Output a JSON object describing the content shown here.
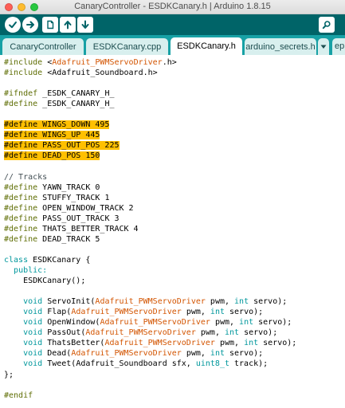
{
  "window": {
    "title": "CanaryController - ESDKCanary.h | Arduino 1.8.15"
  },
  "toolbar": {
    "buttons": [
      {
        "name": "verify",
        "icon": "checkmark-icon"
      },
      {
        "name": "upload",
        "icon": "arrow-right-icon"
      },
      {
        "name": "new",
        "icon": "new-file-icon"
      },
      {
        "name": "open",
        "icon": "arrow-up-icon"
      },
      {
        "name": "save",
        "icon": "arrow-down-icon"
      },
      {
        "name": "serial-monitor",
        "icon": "magnifier-icon"
      }
    ]
  },
  "tabs": [
    {
      "label": "CanaryController",
      "active": false
    },
    {
      "label": "ESDKCanary.cpp",
      "active": false
    },
    {
      "label": "ESDKCanary.h",
      "active": true
    },
    {
      "label": "arduino_secrets.h",
      "active": false
    },
    {
      "label": "ep",
      "active": false
    }
  ],
  "colors": {
    "toolbar": "#006468",
    "tabbar": "#17a1a5",
    "preprocessor": "#5e6d03",
    "keyword": "#00979c",
    "library_class": "#d35400",
    "highlight": "#ffc000"
  },
  "code": [
    [
      {
        "t": "#include ",
        "c": "pre"
      },
      {
        "t": "<",
        "c": ""
      },
      {
        "t": "Adafruit_PWMServoDriver",
        "c": "lib"
      },
      {
        "t": ".h>",
        "c": ""
      }
    ],
    [
      {
        "t": "#include ",
        "c": "pre"
      },
      {
        "t": "<Adafruit_Soundboard.h>",
        "c": ""
      }
    ],
    [],
    [
      {
        "t": "#ifndef ",
        "c": "pre"
      },
      {
        "t": "_ESDK_CANARY_H_",
        "c": ""
      }
    ],
    [
      {
        "t": "#define ",
        "c": "pre"
      },
      {
        "t": "_ESDK_CANARY_H_",
        "c": ""
      }
    ],
    [],
    [
      {
        "t": "#define WINGS_DOWN 495",
        "c": "hl"
      }
    ],
    [
      {
        "t": "#define WINGS_UP 445",
        "c": "hl"
      }
    ],
    [
      {
        "t": "#define PASS_OUT_POS 225",
        "c": "hl"
      }
    ],
    [
      {
        "t": "#define DEAD_POS 150",
        "c": "hl"
      }
    ],
    [],
    [
      {
        "t": "// Tracks",
        "c": "cmt"
      }
    ],
    [
      {
        "t": "#define ",
        "c": "pre"
      },
      {
        "t": "YAWN_TRACK 0",
        "c": ""
      }
    ],
    [
      {
        "t": "#define ",
        "c": "pre"
      },
      {
        "t": "STUFFY_TRACK 1",
        "c": ""
      }
    ],
    [
      {
        "t": "#define ",
        "c": "pre"
      },
      {
        "t": "OPEN_WINDOW_TRACK 2",
        "c": ""
      }
    ],
    [
      {
        "t": "#define ",
        "c": "pre"
      },
      {
        "t": "PASS_OUT_TRACK 3",
        "c": ""
      }
    ],
    [
      {
        "t": "#define ",
        "c": "pre"
      },
      {
        "t": "THATS_BETTER_TRACK 4",
        "c": ""
      }
    ],
    [
      {
        "t": "#define ",
        "c": "pre"
      },
      {
        "t": "DEAD_TRACK 5",
        "c": ""
      }
    ],
    [],
    [
      {
        "t": "class ",
        "c": "kw"
      },
      {
        "t": "ESDKCanary {",
        "c": ""
      }
    ],
    [
      {
        "t": "  ",
        "c": ""
      },
      {
        "t": "public:",
        "c": "kw"
      }
    ],
    [
      {
        "t": "    ESDKCanary();",
        "c": ""
      }
    ],
    [],
    [
      {
        "t": "    ",
        "c": ""
      },
      {
        "t": "void ",
        "c": "kw"
      },
      {
        "t": "ServoInit(",
        "c": ""
      },
      {
        "t": "Adafruit_PWMServoDriver",
        "c": "lib"
      },
      {
        "t": " pwm, ",
        "c": ""
      },
      {
        "t": "int",
        "c": "kw"
      },
      {
        "t": " servo);",
        "c": ""
      }
    ],
    [
      {
        "t": "    ",
        "c": ""
      },
      {
        "t": "void ",
        "c": "kw"
      },
      {
        "t": "Flap(",
        "c": ""
      },
      {
        "t": "Adafruit_PWMServoDriver",
        "c": "lib"
      },
      {
        "t": " pwm, ",
        "c": ""
      },
      {
        "t": "int",
        "c": "kw"
      },
      {
        "t": " servo);",
        "c": ""
      }
    ],
    [
      {
        "t": "    ",
        "c": ""
      },
      {
        "t": "void ",
        "c": "kw"
      },
      {
        "t": "OpenWindow(",
        "c": ""
      },
      {
        "t": "Adafruit_PWMServoDriver",
        "c": "lib"
      },
      {
        "t": " pwm, ",
        "c": ""
      },
      {
        "t": "int",
        "c": "kw"
      },
      {
        "t": " servo);",
        "c": ""
      }
    ],
    [
      {
        "t": "    ",
        "c": ""
      },
      {
        "t": "void ",
        "c": "kw"
      },
      {
        "t": "PassOut(",
        "c": ""
      },
      {
        "t": "Adafruit_PWMServoDriver",
        "c": "lib"
      },
      {
        "t": " pwm, ",
        "c": ""
      },
      {
        "t": "int",
        "c": "kw"
      },
      {
        "t": " servo);",
        "c": ""
      }
    ],
    [
      {
        "t": "    ",
        "c": ""
      },
      {
        "t": "void ",
        "c": "kw"
      },
      {
        "t": "ThatsBetter(",
        "c": ""
      },
      {
        "t": "Adafruit_PWMServoDriver",
        "c": "lib"
      },
      {
        "t": " pwm, ",
        "c": ""
      },
      {
        "t": "int",
        "c": "kw"
      },
      {
        "t": " servo);",
        "c": ""
      }
    ],
    [
      {
        "t": "    ",
        "c": ""
      },
      {
        "t": "void ",
        "c": "kw"
      },
      {
        "t": "Dead(",
        "c": ""
      },
      {
        "t": "Adafruit_PWMServoDriver",
        "c": "lib"
      },
      {
        "t": " pwm, ",
        "c": ""
      },
      {
        "t": "int",
        "c": "kw"
      },
      {
        "t": " servo);",
        "c": ""
      }
    ],
    [
      {
        "t": "    ",
        "c": ""
      },
      {
        "t": "void ",
        "c": "kw"
      },
      {
        "t": "Tweet(Adafruit_Soundboard sfx, ",
        "c": ""
      },
      {
        "t": "uint8_t",
        "c": "kw"
      },
      {
        "t": " track);",
        "c": ""
      }
    ],
    [
      {
        "t": "};",
        "c": ""
      }
    ],
    [],
    [
      {
        "t": "#endif",
        "c": "pre"
      }
    ]
  ]
}
